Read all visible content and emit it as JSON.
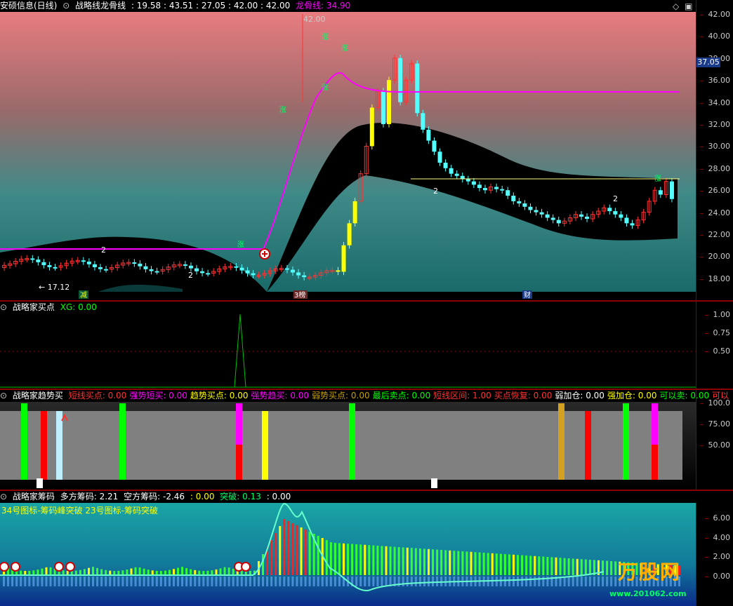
{
  "colors": {
    "bg": "#000000",
    "border": "#8b0000",
    "magenta": "#ff00ff",
    "yellow": "#ffff00",
    "cyan": "#55ffff",
    "red": "#ff3333",
    "green": "#00ff00",
    "white": "#ffffff",
    "gray": "#808080"
  },
  "main": {
    "stock_name": "安硕信息(日线)",
    "indicator_name": "战略线龙骨线",
    "values": ": 19.58 : 43.51 : 27.05 : 42.00 : 42.00",
    "dragon_label": "龙骨线: 34.90",
    "price_ticks": [
      "42.00",
      "40.00",
      "38.00",
      "36.00",
      "34.00",
      "32.00",
      "30.00",
      "28.00",
      "26.00",
      "24.00",
      "22.00",
      "20.00",
      "18.00"
    ],
    "current_price": "37.05",
    "high_label": "42.00",
    "low_label": "17.12",
    "markers": {
      "jian": "减",
      "san": "3榜",
      "cai": "财",
      "num2": "2",
      "zhang": "涨"
    }
  },
  "buy": {
    "title": "战略家买点",
    "xg": "XG: 0.00",
    "ticks": [
      "1.00",
      "0.75",
      "0.50"
    ]
  },
  "trend": {
    "title": "战略家趋势买",
    "items": [
      {
        "label": "短线买点: 0.00",
        "color": "#ff3333"
      },
      {
        "label": "强势短买: 0.00",
        "color": "#ff00ff"
      },
      {
        "label": "趋势买点: 0.00",
        "color": "#ffff00"
      },
      {
        "label": "强势趋买: 0.00",
        "color": "#ff00ff"
      },
      {
        "label": "弱势买点: 0.00",
        "color": "#c8a000"
      },
      {
        "label": "最后卖点: 0.00",
        "color": "#00ff00"
      },
      {
        "label": "短线区间: 1.00",
        "color": "#ff3333"
      },
      {
        "label": "买点恢复: 0.00",
        "color": "#ff3333"
      },
      {
        "label": "弱加仓: 0.00",
        "color": "#ffffff"
      },
      {
        "label": "强加仓: 0.00",
        "color": "#ffff00"
      },
      {
        "label": "可以卖: 0.00",
        "color": "#00ff00"
      },
      {
        "label": "可以",
        "color": "#ff3333"
      }
    ],
    "ticks": [
      "100.0",
      "75.00",
      "50.00"
    ]
  },
  "chips": {
    "title": "战略家筹码",
    "long_label": "多方筹码: 2.21",
    "short_label": "空方筹码: -2.46",
    "mid_label": ": 0.00",
    "break_label": "突破: 0.13",
    "end_label": ": 0.00",
    "icon_note": "34号图标-筹码峰突破 23号图标-筹码突破",
    "ticks": [
      "6.00",
      "4.00",
      "2.00",
      "0.00"
    ]
  },
  "watermark": {
    "site": "www.201062.com",
    "brand": "万股网"
  }
}
